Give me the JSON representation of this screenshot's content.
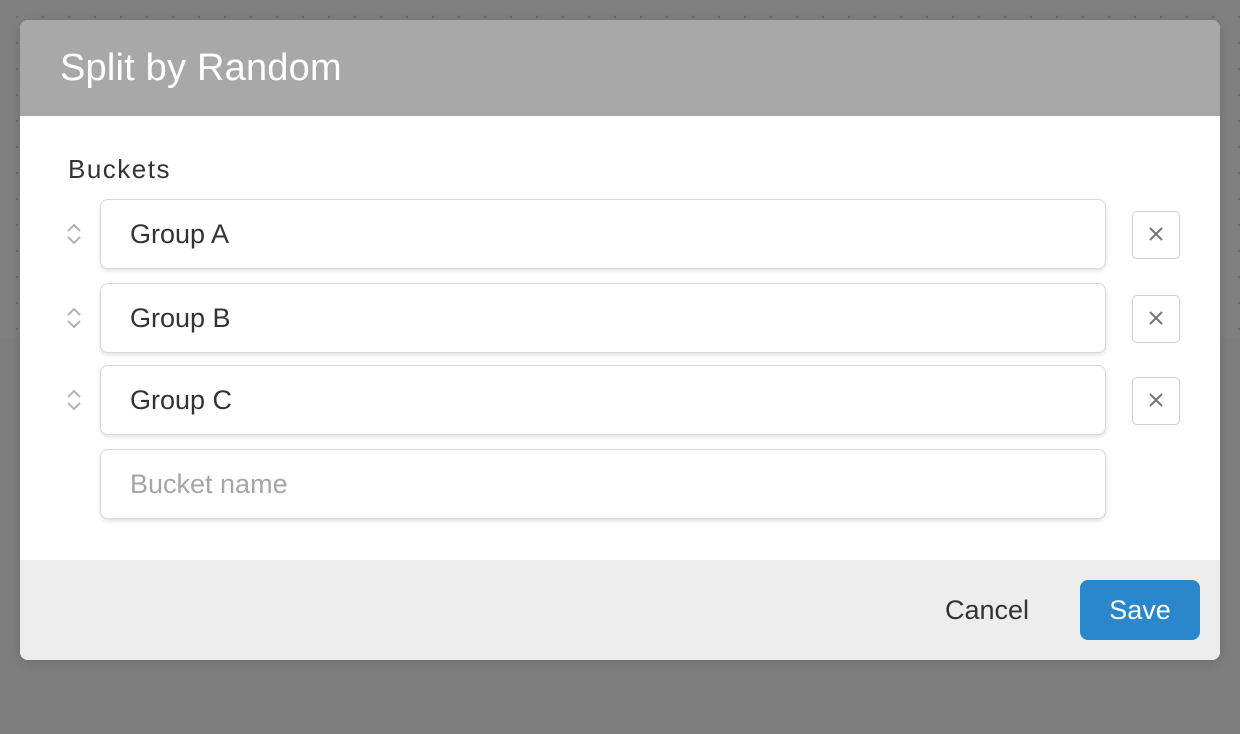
{
  "modal": {
    "title": "Split by Random"
  },
  "buckets": {
    "label": "Buckets",
    "items": [
      {
        "value": "Group A"
      },
      {
        "value": "Group B"
      },
      {
        "value": "Group C"
      }
    ],
    "new_item_placeholder": "Bucket name",
    "new_item_value": ""
  },
  "footer": {
    "cancel_label": "Cancel",
    "save_label": "Save"
  },
  "icons": {
    "drag": "drag-handle-icon",
    "remove": "close-icon"
  },
  "colors": {
    "header_bg": "#a8a8a8",
    "primary_button": "#2b87cc",
    "footer_bg": "#ededed",
    "overlay": "#7e7e7e"
  }
}
